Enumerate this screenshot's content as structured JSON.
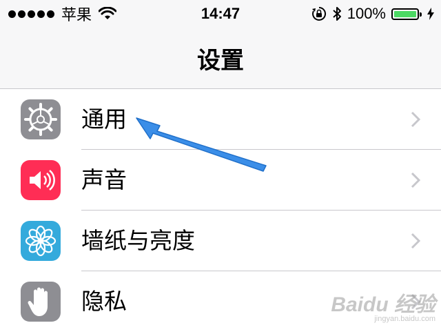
{
  "status_bar": {
    "carrier": "苹果",
    "time": "14:47",
    "battery_percent": "100%",
    "battery_level": 1.0,
    "signal_bars": 5,
    "icons": [
      "signal-dots-icon",
      "wifi-icon",
      "rotation-lock-icon",
      "bluetooth-icon",
      "battery-icon",
      "charging-icon"
    ]
  },
  "nav": {
    "title": "设置"
  },
  "settings": {
    "items": [
      {
        "label": "通用",
        "icon": "gear-icon",
        "icon_color": "#8e8e93"
      },
      {
        "label": "声音",
        "icon": "speaker-icon",
        "icon_color": "#ff2d55"
      },
      {
        "label": "墙纸与亮度",
        "icon": "flower-icon",
        "icon_color": "#34aadc"
      },
      {
        "label": "隐私",
        "icon": "hand-icon",
        "icon_color": "#8e8e93"
      }
    ]
  },
  "annotation": {
    "arrow_color": "#3b8ee8",
    "points_to": "通用"
  },
  "watermark": {
    "logo": "Baidu 经验",
    "url": "jingyan.baidu.com"
  },
  "colors": {
    "accent_green": "#4cd964",
    "separator": "#c8c7cc",
    "chevron": "#c7c7cc"
  }
}
